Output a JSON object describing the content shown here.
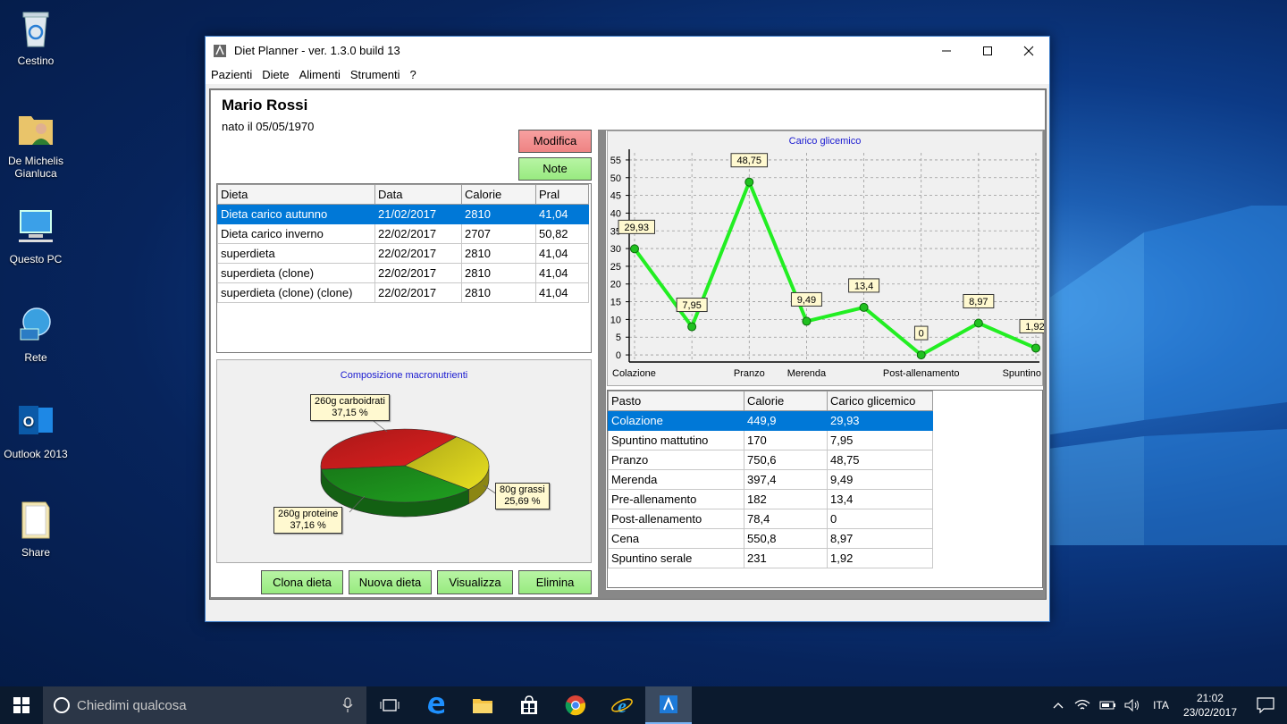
{
  "desktop": {
    "icons": [
      {
        "label": "Cestino",
        "icon": "recycle-bin-icon"
      },
      {
        "label": "De Michelis Gianluca",
        "icon": "user-folder-icon"
      },
      {
        "label": "Questo PC",
        "icon": "computer-icon"
      },
      {
        "label": "Rete",
        "icon": "network-icon"
      },
      {
        "label": "Outlook 2013",
        "icon": "outlook-icon"
      },
      {
        "label": "Share",
        "icon": "folder-icon"
      }
    ]
  },
  "window": {
    "title": "Diet Planner - ver. 1.3.0 build 13",
    "menu": [
      "Pazienti",
      "Diete",
      "Alimenti",
      "Strumenti",
      "?"
    ]
  },
  "patient": {
    "name": "Mario Rossi",
    "born": "nato il 05/05/1970",
    "edit_label": "Modifica",
    "notes_label": "Note"
  },
  "diets": {
    "columns": [
      "Dieta",
      "Data",
      "Calorie",
      "Pral"
    ],
    "rows": [
      [
        "Dieta carico autunno",
        "21/02/2017",
        "2810",
        "41,04"
      ],
      [
        "Dieta carico inverno",
        "22/02/2017",
        "2707",
        "50,82"
      ],
      [
        "superdieta",
        "22/02/2017",
        "2810",
        "41,04"
      ],
      [
        "superdieta (clone)",
        "22/02/2017",
        "2810",
        "41,04"
      ],
      [
        "superdieta (clone) (clone)",
        "22/02/2017",
        "2810",
        "41,04"
      ]
    ],
    "selected": 0
  },
  "actions": {
    "clone": "Clona dieta",
    "new": "Nuova dieta",
    "view": "Visualizza",
    "delete": "Elimina"
  },
  "meals": {
    "columns": [
      "Pasto",
      "Calorie",
      "Carico glicemico"
    ],
    "rows": [
      [
        "Colazione",
        "449,9",
        "29,93"
      ],
      [
        "Spuntino mattutino",
        "170",
        "7,95"
      ],
      [
        "Pranzo",
        "750,6",
        "48,75"
      ],
      [
        "Merenda",
        "397,4",
        "9,49"
      ],
      [
        "Pre-allenamento",
        "182",
        "13,4"
      ],
      [
        "Post-allenamento",
        "78,4",
        "0"
      ],
      [
        "Cena",
        "550,8",
        "8,97"
      ],
      [
        "Spuntino serale",
        "231",
        "1,92"
      ]
    ],
    "selected": 0
  },
  "chart_data": [
    {
      "type": "pie",
      "title": "Composizione macronutrienti",
      "slices": [
        {
          "label": "260g carboidrati",
          "percent_label": "37,15 %",
          "value": 37.15,
          "color": "#e02020"
        },
        {
          "label": "80g grassi",
          "percent_label": "25,69 %",
          "value": 25.69,
          "color": "#e8e020"
        },
        {
          "label": "260g proteine",
          "percent_label": "37,16 %",
          "value": 37.16,
          "color": "#20a020"
        }
      ]
    },
    {
      "type": "line",
      "title": "Carico glicemico",
      "categories": [
        "Colazione",
        "Spuntino mattutino",
        "Pranzo",
        "Merenda",
        "Pre-allenamento",
        "Post-allenamento",
        "Cena",
        "Spuntino serale"
      ],
      "x_tick_labels": [
        "Colazione",
        "",
        "Pranzo",
        "Merenda",
        "",
        "Post-allenamento",
        "",
        "Spuntino"
      ],
      "values": [
        29.93,
        7.95,
        48.75,
        9.49,
        13.4,
        0,
        8.97,
        1.92
      ],
      "value_labels": [
        "29,93",
        "7,95",
        "48,75",
        "9,49",
        "13,4",
        "0",
        "8,97",
        "1,92"
      ],
      "ylim": [
        -2,
        57
      ],
      "yticks": [
        0,
        5,
        10,
        15,
        20,
        25,
        30,
        35,
        40,
        45,
        50,
        55
      ],
      "grid": true,
      "color": "#22ee22"
    }
  ],
  "taskbar": {
    "search_placeholder": "Chiedimi qualcosa",
    "language": "ITA",
    "time": "21:02",
    "date": "23/02/2017"
  }
}
